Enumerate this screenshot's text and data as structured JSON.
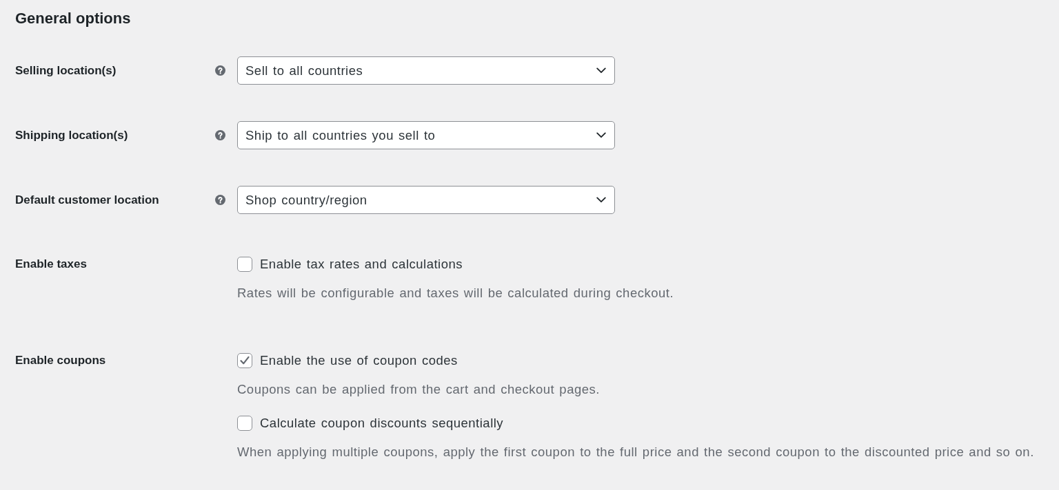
{
  "title": "General options",
  "settings": [
    {
      "kind": "select",
      "label": "Selling location(s)",
      "help_tip": true,
      "value": "Sell to all countries"
    },
    {
      "kind": "select",
      "label": "Shipping location(s)",
      "help_tip": true,
      "value": "Ship to all countries you sell to"
    },
    {
      "kind": "select",
      "label": "Default customer location",
      "help_tip": true,
      "value": "Shop country/region"
    },
    {
      "kind": "checkboxes",
      "label": "Enable taxes",
      "help_tip": false,
      "options": [
        {
          "text": "Enable tax rates and calculations",
          "checked": false,
          "description": "Rates will be configurable and taxes will be calculated during checkout."
        }
      ]
    },
    {
      "kind": "checkboxes",
      "label": "Enable coupons",
      "help_tip": false,
      "options": [
        {
          "text": "Enable the use of coupon codes",
          "checked": true,
          "description": "Coupons can be applied from the cart and checkout pages."
        },
        {
          "text": "Calculate coupon discounts sequentially",
          "checked": false,
          "description": "When applying multiple coupons, apply the first coupon to the full price and the second coupon to the discounted price and so on."
        }
      ]
    }
  ]
}
